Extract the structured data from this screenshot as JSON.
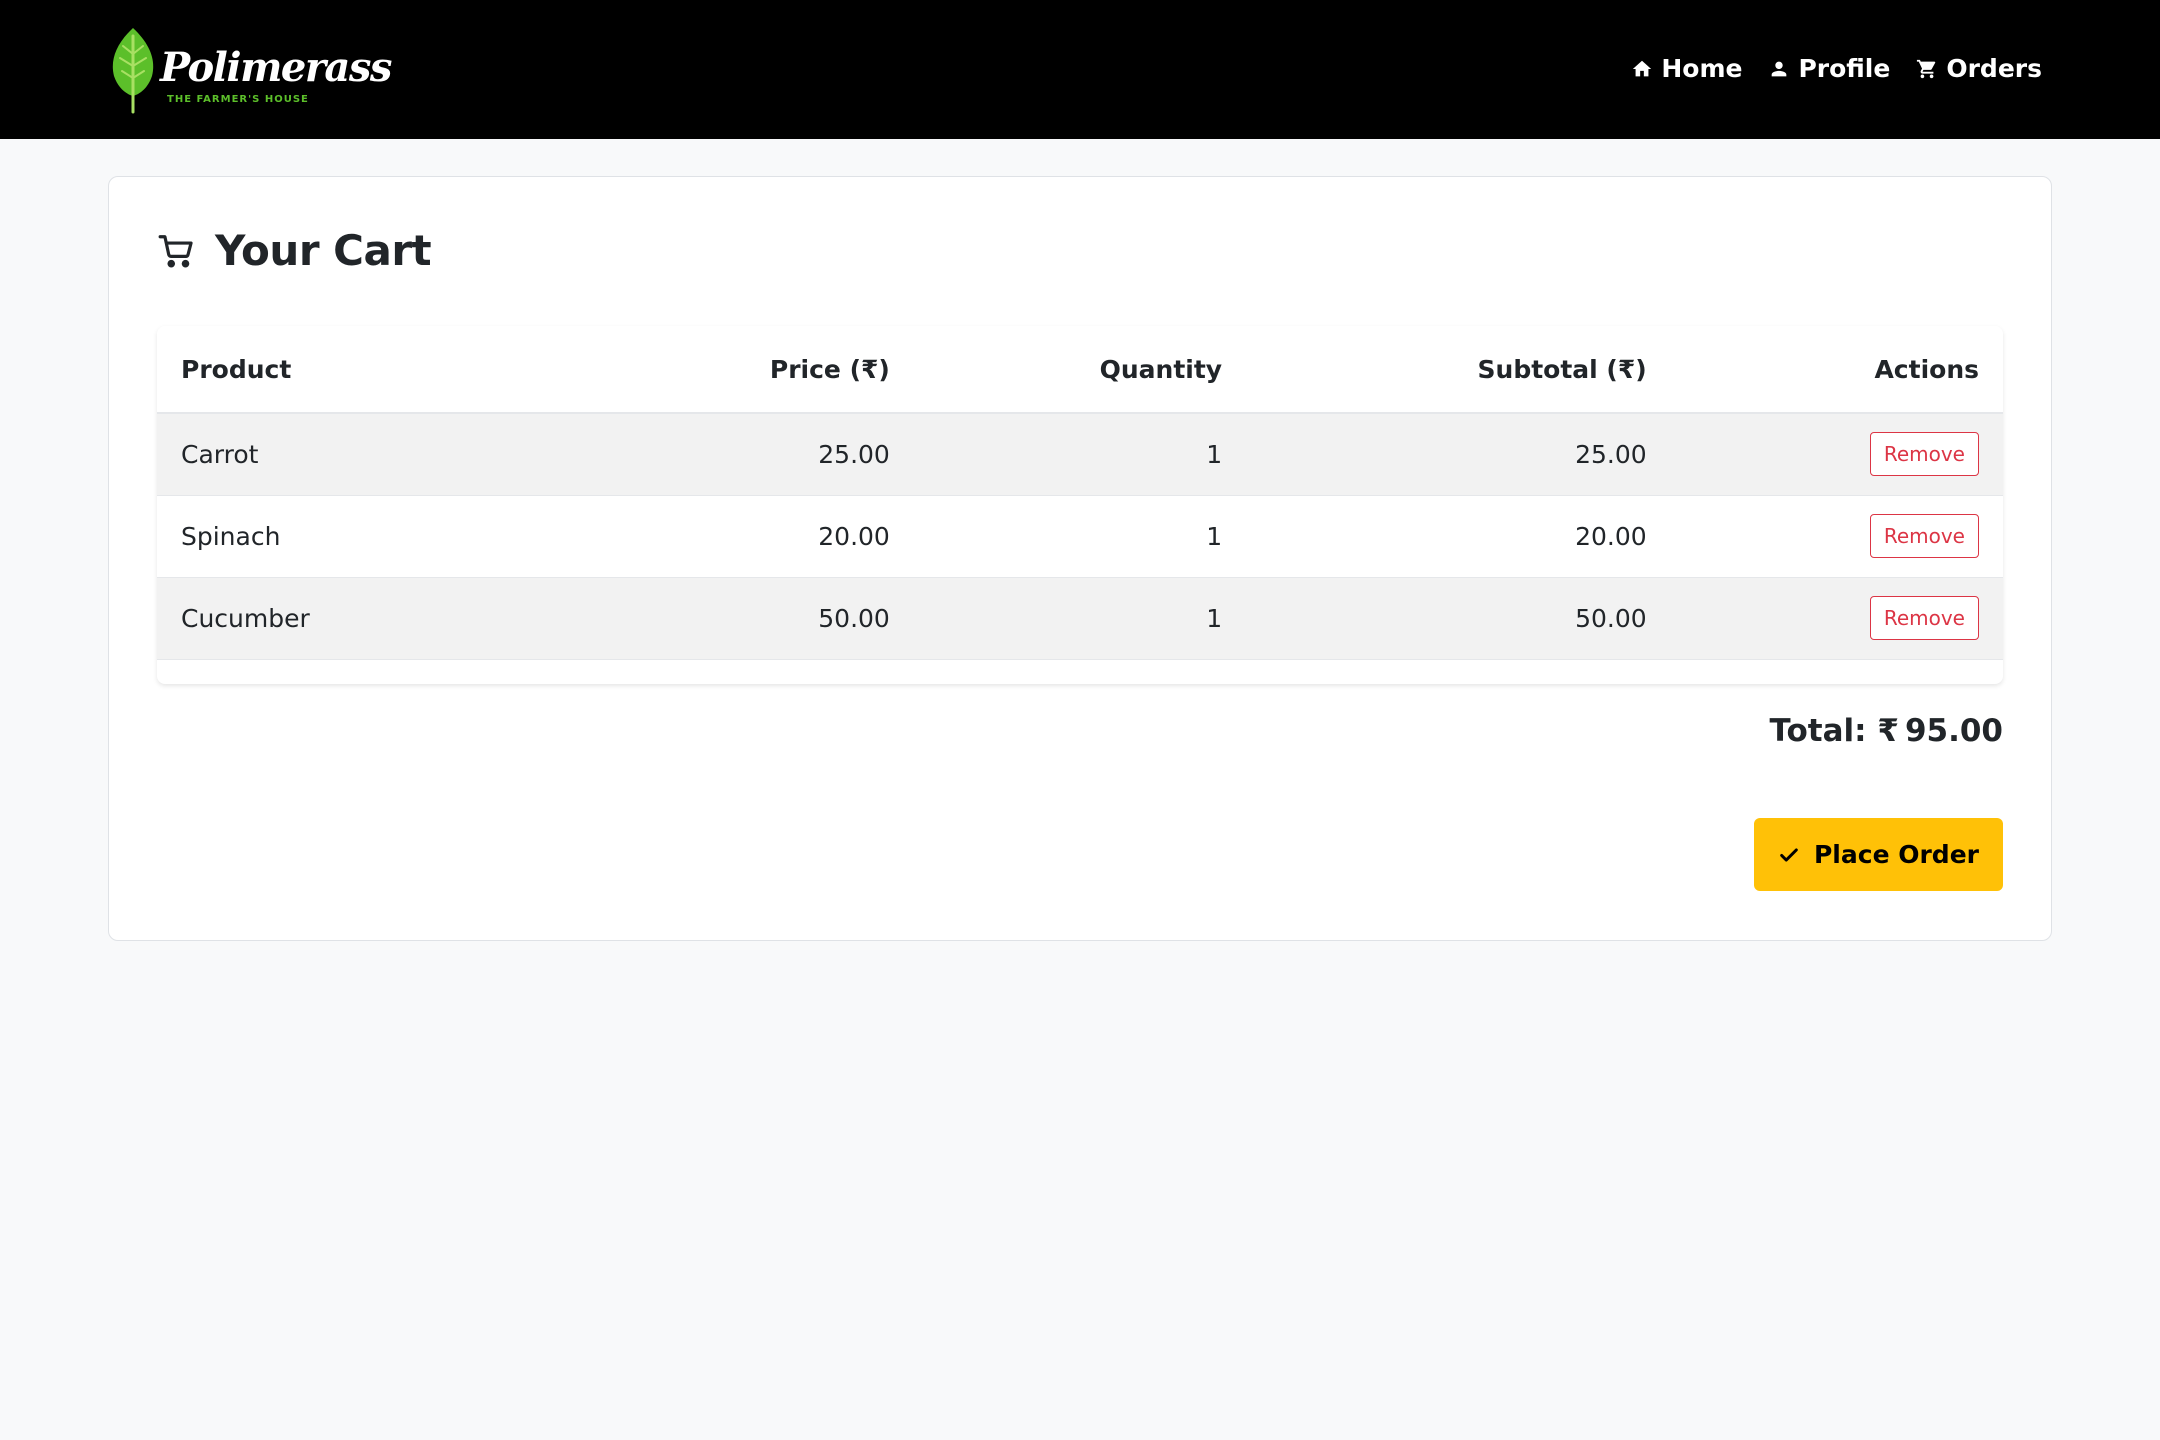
{
  "brand": {
    "name": "Polimerass",
    "tagline": "THE FARMER'S HOUSE",
    "leaf_color": "#5cbf2a"
  },
  "nav": {
    "home": {
      "label": "Home",
      "icon": "home-icon"
    },
    "profile": {
      "label": "Profile",
      "icon": "user-icon"
    },
    "orders": {
      "label": "Orders",
      "icon": "cart-icon"
    }
  },
  "cart": {
    "title": "Your Cart",
    "icon": "cart-icon",
    "columns": {
      "product": "Product",
      "price": "Price (₹)",
      "quantity": "Quantity",
      "subtotal": "Subtotal (₹)",
      "actions": "Actions"
    },
    "rows": [
      {
        "product": "Carrot",
        "price": "25.00",
        "quantity": "1",
        "subtotal": "25.00",
        "action": "Remove"
      },
      {
        "product": "Spinach",
        "price": "20.00",
        "quantity": "1",
        "subtotal": "20.00",
        "action": "Remove"
      },
      {
        "product": "Cucumber",
        "price": "50.00",
        "quantity": "1",
        "subtotal": "50.00",
        "action": "Remove"
      }
    ],
    "total_label": "Total: ₹",
    "total_value": "95.00",
    "place_order_label": "Place Order"
  },
  "colors": {
    "navbar": "#000000",
    "accent_button": "#ffc107",
    "danger": "#dc3545",
    "background": "#f8f9fa"
  }
}
